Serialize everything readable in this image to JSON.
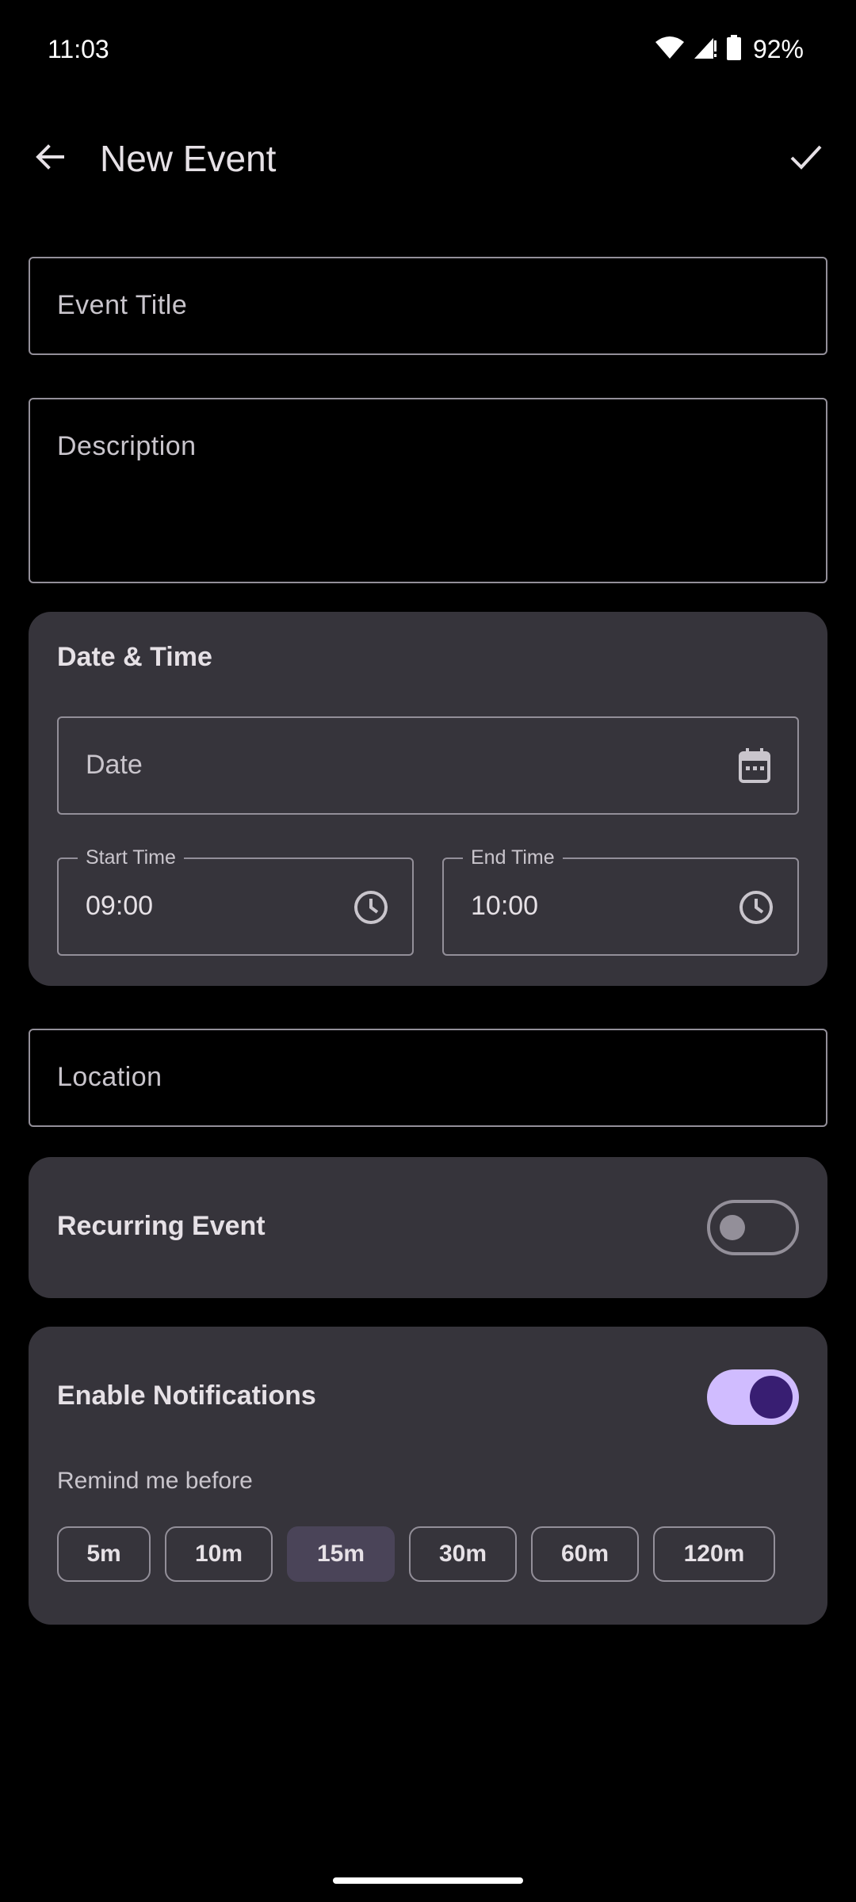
{
  "status_bar": {
    "time": "11:03",
    "battery": "92%",
    "icons": [
      "wifi-icon",
      "cell-signal-icon",
      "battery-icon"
    ]
  },
  "app_bar": {
    "title": "New Event",
    "back_icon": "arrow-back-icon",
    "save_icon": "check-icon"
  },
  "form": {
    "title_placeholder": "Event Title",
    "description_placeholder": "Description",
    "location_placeholder": "Location"
  },
  "date_time": {
    "heading": "Date & Time",
    "date_placeholder": "Date",
    "start_label": "Start Time",
    "start_value": "09:00",
    "end_label": "End Time",
    "end_value": "10:00"
  },
  "recurring": {
    "label": "Recurring Event",
    "enabled": false
  },
  "notifications": {
    "label": "Enable Notifications",
    "enabled": true,
    "remind_label": "Remind me before",
    "options": [
      "5m",
      "10m",
      "15m",
      "30m",
      "60m",
      "120m"
    ],
    "selected": "15m"
  },
  "colors": {
    "background": "#000000",
    "card": "#36343b",
    "accent": "#d0bcff",
    "accent_dark": "#381e72",
    "chip_selected": "#4a4458"
  }
}
